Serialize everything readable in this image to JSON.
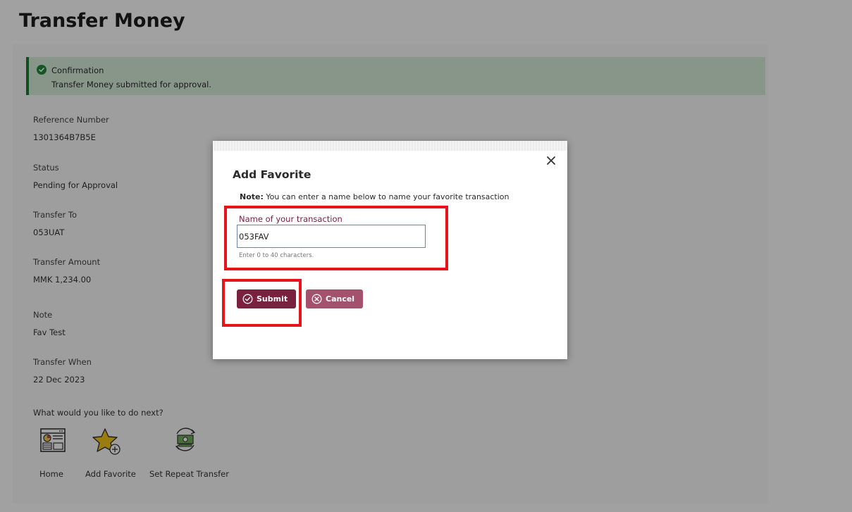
{
  "page": {
    "title": "Transfer Money"
  },
  "confirmation": {
    "title": "Confirmation",
    "message": "Transfer Money submitted for approval."
  },
  "details": [
    {
      "label": "Reference Number",
      "value": "1301364B7B5E"
    },
    {
      "label": "Status",
      "value": "Pending for Approval"
    },
    {
      "label": "Transfer To",
      "value": "053UAT"
    },
    {
      "label": "Transfer Amount",
      "value": "MMK 1,234.00"
    },
    {
      "label": "Note",
      "value": "Fav Test"
    },
    {
      "label": "Transfer When",
      "value": "22 Dec 2023"
    }
  ],
  "next_steps": {
    "title": "What would you like to do next?",
    "actions": [
      {
        "label": "Home",
        "icon": "home-dashboard-icon"
      },
      {
        "label": "Add Favorite",
        "icon": "star-add-icon"
      },
      {
        "label": "Set Repeat Transfer",
        "icon": "repeat-money-icon"
      }
    ]
  },
  "modal": {
    "title": "Add Favorite",
    "note_prefix": "Note:",
    "note_text": " You can enter a name below to name your favorite transaction",
    "input_label": "Name of your transaction",
    "input_value": "053FAV",
    "hint": "Enter 0 to 40 characters.",
    "submit_label": "Submit",
    "cancel_label": "Cancel"
  },
  "colors": {
    "brand": "#7b2140",
    "brand_light": "#a4516d",
    "success": "#1e8a39",
    "success_bg": "#d7ecd9",
    "annotation": "#e8141b"
  }
}
